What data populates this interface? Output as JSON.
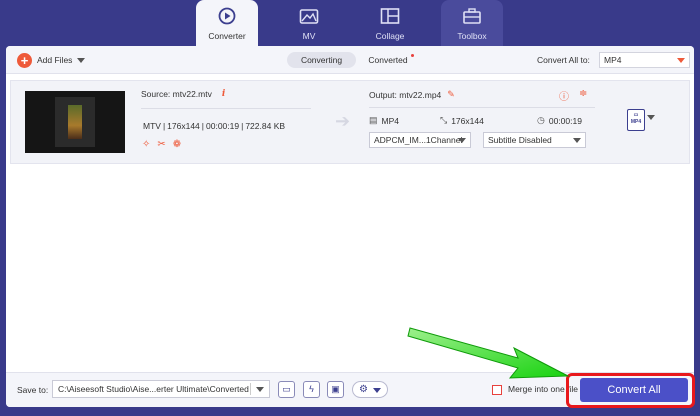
{
  "nav": {
    "tabs": [
      {
        "label": "Converter",
        "icon": "converter-icon",
        "active": true
      },
      {
        "label": "MV",
        "icon": "mv-icon",
        "active": false
      },
      {
        "label": "Collage",
        "icon": "collage-icon",
        "active": false
      },
      {
        "label": "Toolbox",
        "icon": "toolbox-icon",
        "active": false
      }
    ]
  },
  "toolbar": {
    "add_files": "Add Files",
    "converting": "Converting",
    "converted": "Converted",
    "convert_all_to": "Convert All to:",
    "format": "MP4"
  },
  "file": {
    "source": "Source: mtv22.mtv",
    "format": "MTV",
    "resolution": "176x144",
    "duration": "00:00:19",
    "size": "722.84 KB",
    "output": "Output: mtv22.mp4",
    "out_format": "MP4",
    "out_resolution": "176x144",
    "out_duration": "00:00:19",
    "audio_track": "ADPCM_IM...1Channel",
    "subtitle": "Subtitle Disabled",
    "format_badge": "MP4"
  },
  "bottom": {
    "save_to": "Save to:",
    "path": "C:\\Aiseesoft Studio\\Aise...erter Ultimate\\Converted",
    "merge_label": "Merge into one file",
    "convert_all": "Convert All"
  },
  "colors": {
    "nav_bg": "#393a8a",
    "accent": "#ee5a3a",
    "primary_button": "#4b50c8",
    "highlight": "#e8181c",
    "annotation_arrow": "#22e21a"
  }
}
